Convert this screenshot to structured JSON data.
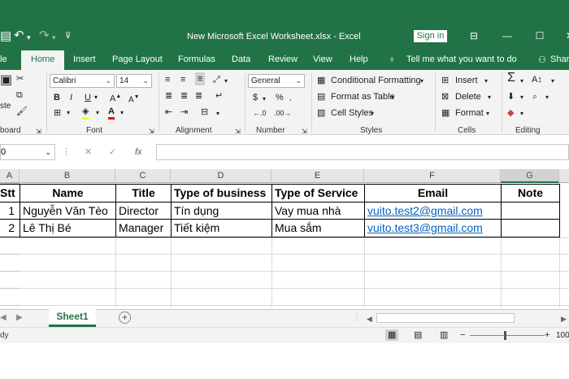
{
  "window": {
    "title": "New Microsoft Excel Worksheet.xlsx  -  Excel",
    "signin": "Sign in"
  },
  "tabs": [
    "le",
    "Home",
    "Insert",
    "Page Layout",
    "Formulas",
    "Data",
    "Review",
    "View",
    "Help",
    "Tell me what you want to do",
    "Share"
  ],
  "ribbon": {
    "clipboard": {
      "paste": "ste",
      "label": "board"
    },
    "font": {
      "name": "Calibri",
      "size": "14",
      "label": "Font",
      "bold": "B",
      "italic": "I",
      "underline": "U"
    },
    "alignment": {
      "label": "Alignment"
    },
    "number": {
      "format": "General",
      "label": "Number",
      "currency": "$",
      "percent": "%"
    },
    "styles": {
      "cond": "Conditional Formatting",
      "table": "Format as Table",
      "cell": "Cell Styles",
      "label": "Styles"
    },
    "cells": {
      "insert": "Insert",
      "delete": "Delete",
      "format": "Format",
      "label": "Cells"
    },
    "editing": {
      "label": "Editing"
    }
  },
  "formula": {
    "namebox": "0",
    "fx": "fx"
  },
  "grid": {
    "columns": [
      "A",
      "B",
      "C",
      "D",
      "E",
      "F",
      "G"
    ],
    "header": [
      "Stt",
      "Name",
      "Title",
      "Type of business",
      "Type of Service",
      "Email",
      "Note"
    ],
    "rows": [
      [
        "1",
        "Nguyễn Văn Tèo",
        "Director",
        "Tín dụng",
        "Vay mua nhà",
        "vuito.test2@gmail.com",
        ""
      ],
      [
        "2",
        "Lê Thị Bé",
        "Manager",
        "Tiết kiệm",
        "Mua sắm",
        "vuito.test3@gmail.com",
        ""
      ]
    ]
  },
  "sheets": [
    "Sheet1"
  ],
  "status": {
    "left": "dy",
    "zoom": "100"
  },
  "colors": {
    "excel_green": "#217346",
    "link": "#0563c1"
  }
}
